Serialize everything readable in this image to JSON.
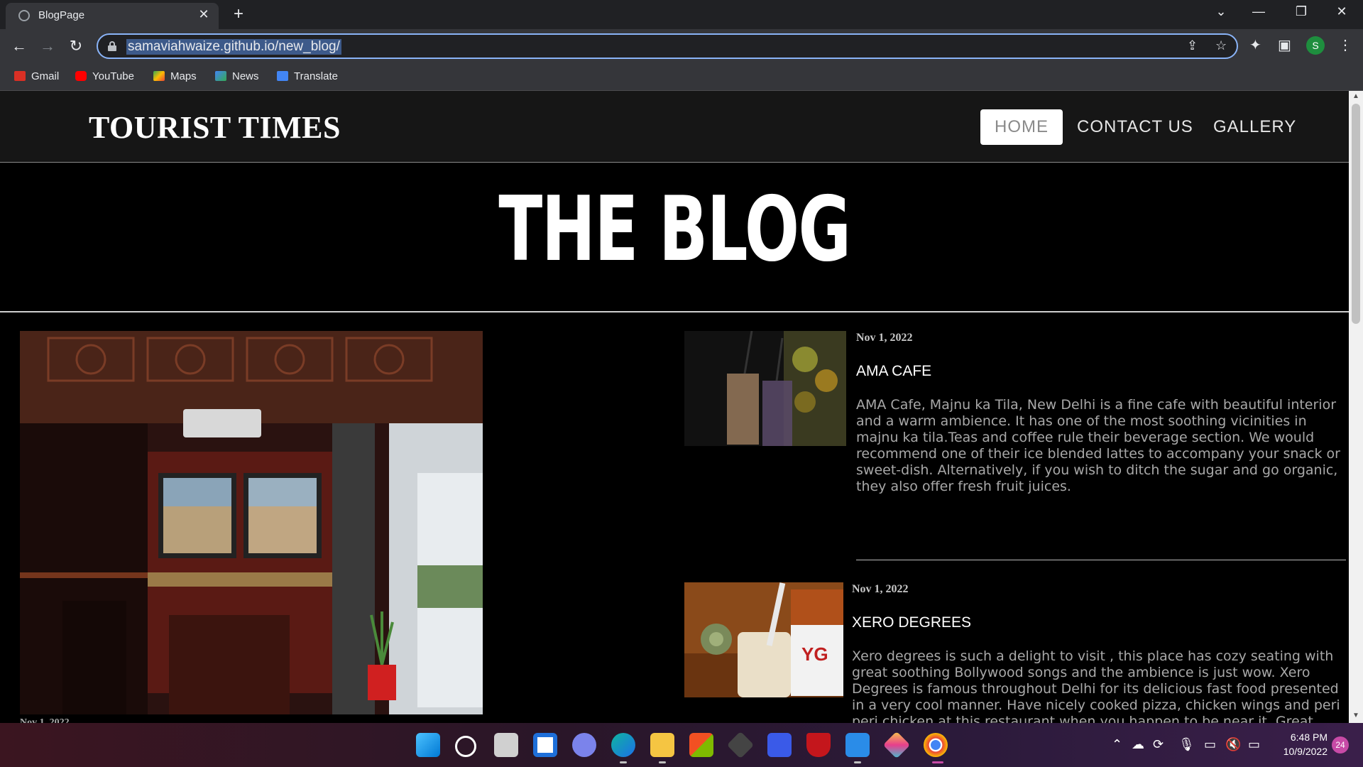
{
  "browser": {
    "tab_title": "BlogPage",
    "url": "samaviahwaize.github.io/new_blog/",
    "bookmarks": [
      "Gmail",
      "YouTube",
      "Maps",
      "News",
      "Translate"
    ],
    "profile_initial": "S"
  },
  "site": {
    "title": "TOURIST TIMES",
    "nav": [
      "HOME",
      "CONTACT US",
      "GALLERY"
    ],
    "hero_title": "THE BLOG"
  },
  "featured": {
    "date": "Nov 1, 2022"
  },
  "posts": [
    {
      "date": "Nov 1, 2022",
      "title": "AMA CAFE",
      "excerpt": "AMA Cafe, Majnu ka Tila, New Delhi is a fine cafe with beautiful interior and a warm ambience. It has one of the most soothing vicinities in majnu ka tila.Teas and coffee rule their beverage section. We would recommend one of their ice blended lattes to accompany your snack or sweet-dish. Alternatively, if you wish to ditch the sugar and go organic, they also offer fresh fruit juices."
    },
    {
      "date": "Nov 1, 2022",
      "title": "XERO DEGREES",
      "excerpt": "Xero degrees is such a delight to visit , this place has cozy seating with great soothing Bollywood songs and the ambience is just wow. Xero Degrees is famous throughout Delhi for its delicious fast food presented in a very cool manner. Have nicely cooked pizza, chicken wings and peri peri chicken at this restaurant when you happen to be near it. Great coffee will make"
    }
  ],
  "taskbar": {
    "time": "6:48 PM",
    "date": "10/9/2022",
    "notifications": "24"
  },
  "colors": {
    "page_bg": "#000000",
    "header_bg": "#161616",
    "accent_omnibox": "#8ab4f8"
  }
}
